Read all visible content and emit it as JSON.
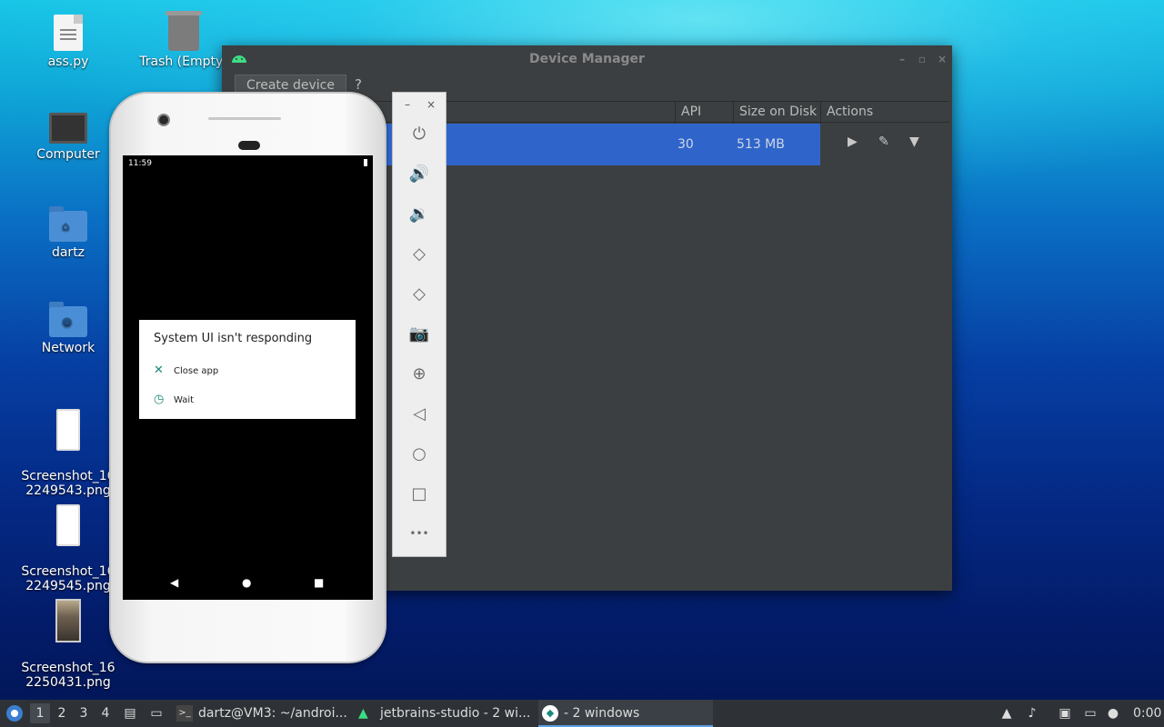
{
  "desktop": {
    "icons": [
      {
        "label": "ass.py"
      },
      {
        "label": "Trash (Empty)"
      },
      {
        "label": "Computer"
      },
      {
        "label": "dartz"
      },
      {
        "label": "Network"
      },
      {
        "label": "Screenshot_16\n2249543.png"
      },
      {
        "label": "Screenshot_16\n2249545.png"
      },
      {
        "label": "Screenshot_16\n2250431.png"
      }
    ]
  },
  "device_manager": {
    "title": "Device Manager",
    "create_button": "Create device",
    "help": "?",
    "columns": {
      "api": "API",
      "size": "Size on Disk",
      "actions": "Actions"
    },
    "row": {
      "api": "30",
      "size": "513 MB"
    },
    "window_controls": [
      "–",
      "▫",
      "×"
    ]
  },
  "emulator": {
    "window_controls": {
      "minimize": "–",
      "close": "×"
    },
    "tools": [
      {
        "icon": "power-icon",
        "glyph": "⏻"
      },
      {
        "icon": "volume-up-icon",
        "glyph": "🔊"
      },
      {
        "icon": "volume-down-icon",
        "glyph": "🔉"
      },
      {
        "icon": "rotate-left-icon",
        "glyph": "◇"
      },
      {
        "icon": "rotate-right-icon",
        "glyph": "◇"
      },
      {
        "icon": "camera-icon",
        "glyph": "📷"
      },
      {
        "icon": "zoom-icon",
        "glyph": "⊕"
      },
      {
        "icon": "back-icon",
        "glyph": "◁"
      },
      {
        "icon": "home-icon",
        "glyph": "○"
      },
      {
        "icon": "overview-icon",
        "glyph": "□"
      },
      {
        "icon": "more-icon",
        "glyph": "•••"
      }
    ]
  },
  "phone": {
    "status_time": "11:59",
    "dialog": {
      "title": "System UI isn't responding",
      "option_close": "Close app",
      "option_wait": "Wait"
    }
  },
  "taskbar": {
    "workspaces": [
      "1",
      "2",
      "3",
      "4"
    ],
    "tasks": [
      {
        "label": "dartz@VM3: ~/androi..."
      },
      {
        "label": "jetbrains-studio - 2 wi..."
      },
      {
        "label": "- 2 windows"
      }
    ],
    "clock": "0:00"
  },
  "colors": {
    "selection": "#2f65ca",
    "panel": "#3c3f41",
    "taskbar": "#2e3236"
  }
}
